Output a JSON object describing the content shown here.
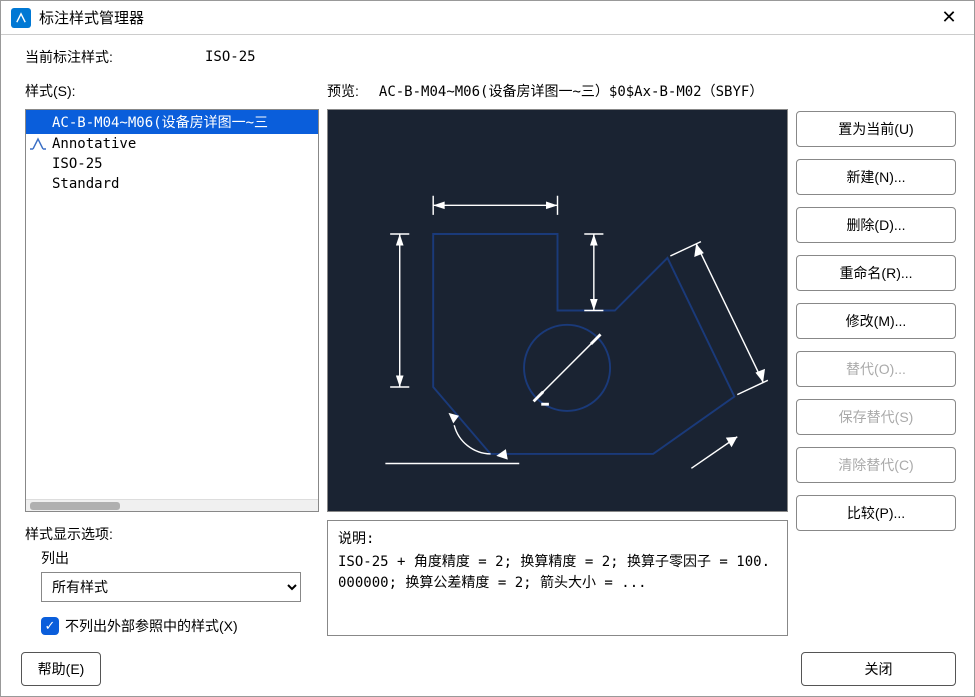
{
  "window_title": "标注样式管理器",
  "current_style_label": "当前标注样式:",
  "current_style_value": "ISO-25",
  "styles_label": "样式(S):",
  "preview_label": "预览:",
  "preview_name": "AC-B-M04~M06(设备房详图一~三）$0$Ax-B-M02（SBYF）",
  "styles": [
    {
      "label": "AC-B-M04~M06(设备房详图一~三",
      "icon": "spacer"
    },
    {
      "label": "Annotative",
      "icon": "anno"
    },
    {
      "label": "ISO-25",
      "icon": "spacer"
    },
    {
      "label": "Standard",
      "icon": "spacer"
    }
  ],
  "selected_style_index": 0,
  "buttons": {
    "set_current": "置为当前(U)",
    "new": "新建(N)...",
    "delete": "删除(D)...",
    "rename": "重命名(R)...",
    "modify": "修改(M)...",
    "override": "替代(O)...",
    "save_override": "保存替代(S)",
    "clear_override": "清除替代(C)",
    "compare": "比较(P)..."
  },
  "display_options": {
    "heading": "样式显示选项:",
    "list_label": "列出",
    "list_value": "所有样式",
    "checkbox_label": "不列出外部参照中的样式(X)",
    "checkbox_checked": true
  },
  "description": {
    "heading": "说明:",
    "body": "ISO-25 + 角度精度 = 2; 换算精度 = 2; 换算子零因子 = 100.000000; 换算公差精度 = 2; 箭头大小  = ..."
  },
  "footer": {
    "help": "帮助(E)",
    "close": "关闭"
  }
}
